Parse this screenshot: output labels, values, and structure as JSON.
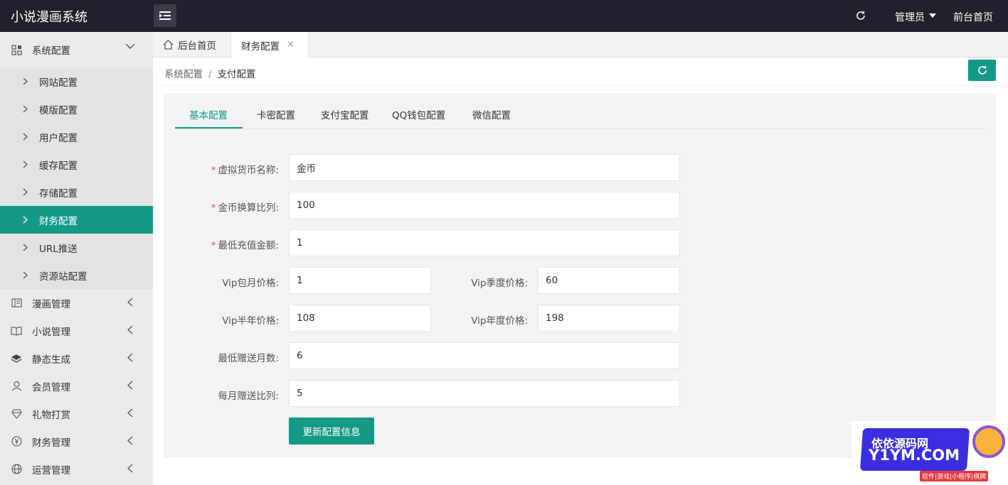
{
  "header": {
    "brand": "小说漫画系统",
    "admin_label": "管理员",
    "frontpage_label": "前台首页"
  },
  "sidebar": {
    "system_config": "系统配置",
    "sub_items": [
      "网站配置",
      "模版配置",
      "用户配置",
      "缓存配置",
      "存储配置",
      "财务配置",
      "URL推送",
      "资源站配置"
    ],
    "groups": [
      "漫画管理",
      "小说管理",
      "静态生成",
      "会员管理",
      "礼物打赏",
      "财务管理",
      "运营管理"
    ]
  },
  "tabs": {
    "home": "后台首页",
    "current": "财务配置",
    "close_glyph": "✕"
  },
  "breadcrumb": {
    "parent": "系统配置",
    "separator": "/",
    "current": "支付配置"
  },
  "subtabs": [
    "基本配置",
    "卡密配置",
    "支付宝配置",
    "QQ钱包配置",
    "微信配置"
  ],
  "form": {
    "currency_name_label": "虚拟货币名称:",
    "currency_name_value": "金币",
    "exchange_ratio_label": "金币换算比列:",
    "exchange_ratio_value": "100",
    "min_recharge_label": "最低充值金额:",
    "min_recharge_value": "1",
    "vip_month_label": "Vip包月价格:",
    "vip_month_value": "1",
    "vip_quarter_label": "Vip季度价格:",
    "vip_quarter_value": "60",
    "vip_half_label": "Vip半年价格:",
    "vip_half_value": "108",
    "vip_year_label": "Vip年度价格:",
    "vip_year_value": "198",
    "min_gift_months_label": "最低赠送月数:",
    "min_gift_months_value": "6",
    "monthly_gift_ratio_label": "每月赠送比列:",
    "monthly_gift_ratio_value": "5",
    "required_mark": "*",
    "submit_label": "更新配置信息"
  },
  "watermark": {
    "line1": "依依源码网",
    "line2": "Y1YM.COM",
    "line3": "软件|游戏|小程序|棋牌"
  },
  "colors": {
    "accent": "#139a87",
    "header_bg": "#20222a",
    "required": "#e0573b"
  }
}
